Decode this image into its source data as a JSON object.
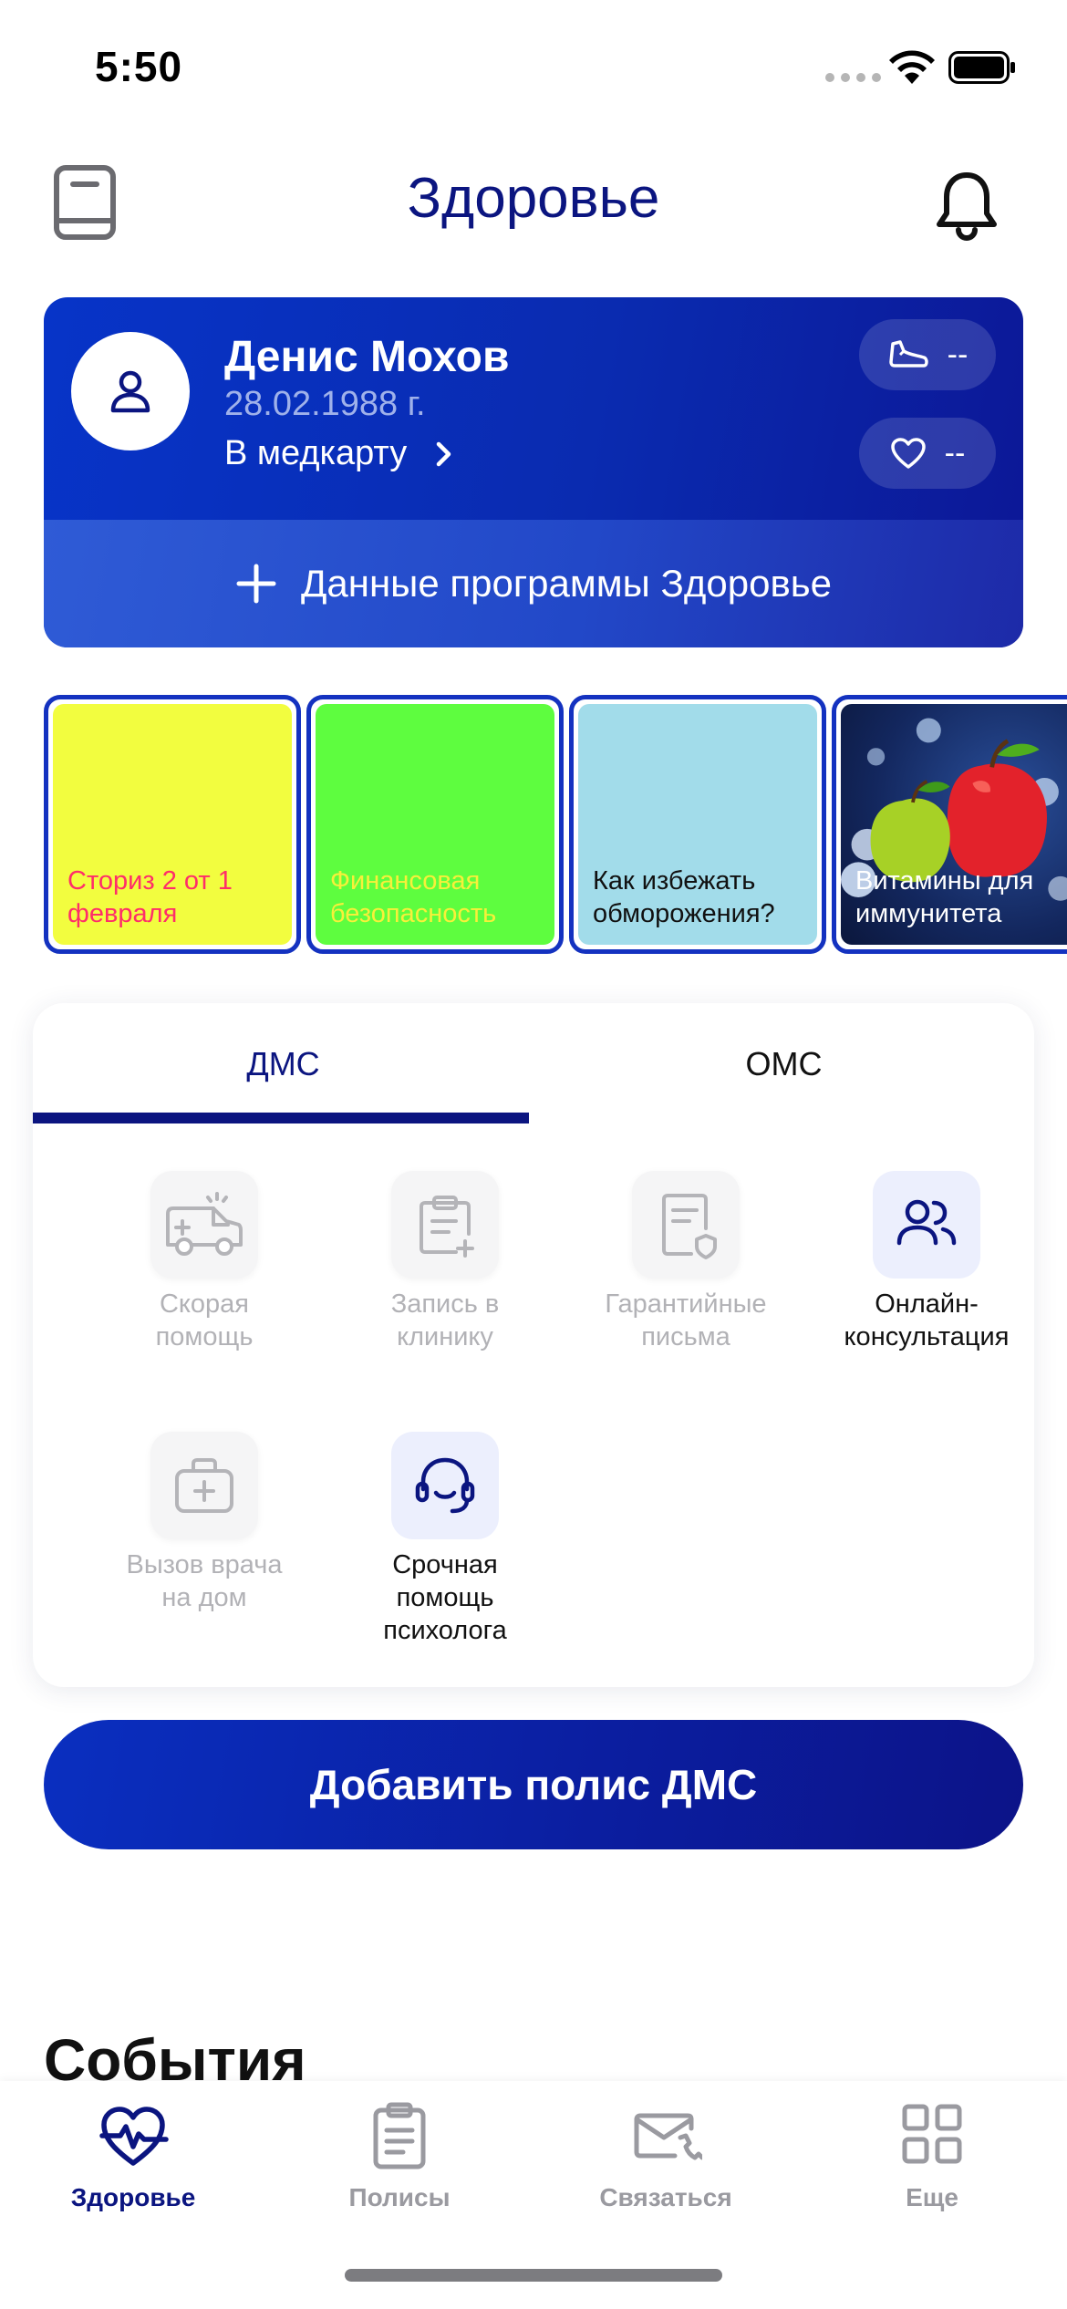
{
  "status_bar": {
    "time": "5:50"
  },
  "header": {
    "title": "Здоровье"
  },
  "profile": {
    "name": "Денис Мохов",
    "dob": "28.02.1988 г.",
    "medcard_link": "В медкарту",
    "steps_value": "--",
    "heart_value": "--",
    "program_button": "Данные программы Здоровье"
  },
  "stories": [
    {
      "title": "Сториз 2 от 1 февраля",
      "color": "#f2fd3f"
    },
    {
      "title": "Финансовая безопасность",
      "color": "#5efd3f"
    },
    {
      "title": "Как избежать обморожения?",
      "color": "#a2dcea"
    },
    {
      "title": "Витамины для иммунитета",
      "color": "#13275e"
    }
  ],
  "tabs": [
    {
      "label": "ДМС",
      "selected": true
    },
    {
      "label": "ОМС",
      "selected": false
    }
  ],
  "services": [
    {
      "label": "Скорая помощь",
      "icon": "ambulance-icon",
      "enabled": false
    },
    {
      "label": "Запись в клинику",
      "icon": "clipboard-plus-icon",
      "enabled": false
    },
    {
      "label": "Гарантийные письма",
      "icon": "document-shield-icon",
      "enabled": false
    },
    {
      "label": "Онлайн-консультация",
      "icon": "users-icon",
      "enabled": true
    },
    {
      "label": "Вызов врача на дом",
      "icon": "medical-bag-icon",
      "enabled": false
    },
    {
      "label": "Срочная помощь психолога",
      "icon": "headset-icon",
      "enabled": true
    }
  ],
  "add_policy_button": "Добавить полис ДМС",
  "events_title": "События",
  "nav": [
    {
      "label": "Здоровье",
      "icon": "heart-pulse-icon",
      "current": true
    },
    {
      "label": "Полисы",
      "icon": "clipboard-icon",
      "current": false
    },
    {
      "label": "Связаться",
      "icon": "mail-phone-icon",
      "current": false
    },
    {
      "label": "Еще",
      "icon": "grid-icon",
      "current": false
    }
  ],
  "colors": {
    "brand": "#0b1580",
    "card_gradient_start": "#0734c8",
    "disabled_text": "#b2b2b6"
  }
}
